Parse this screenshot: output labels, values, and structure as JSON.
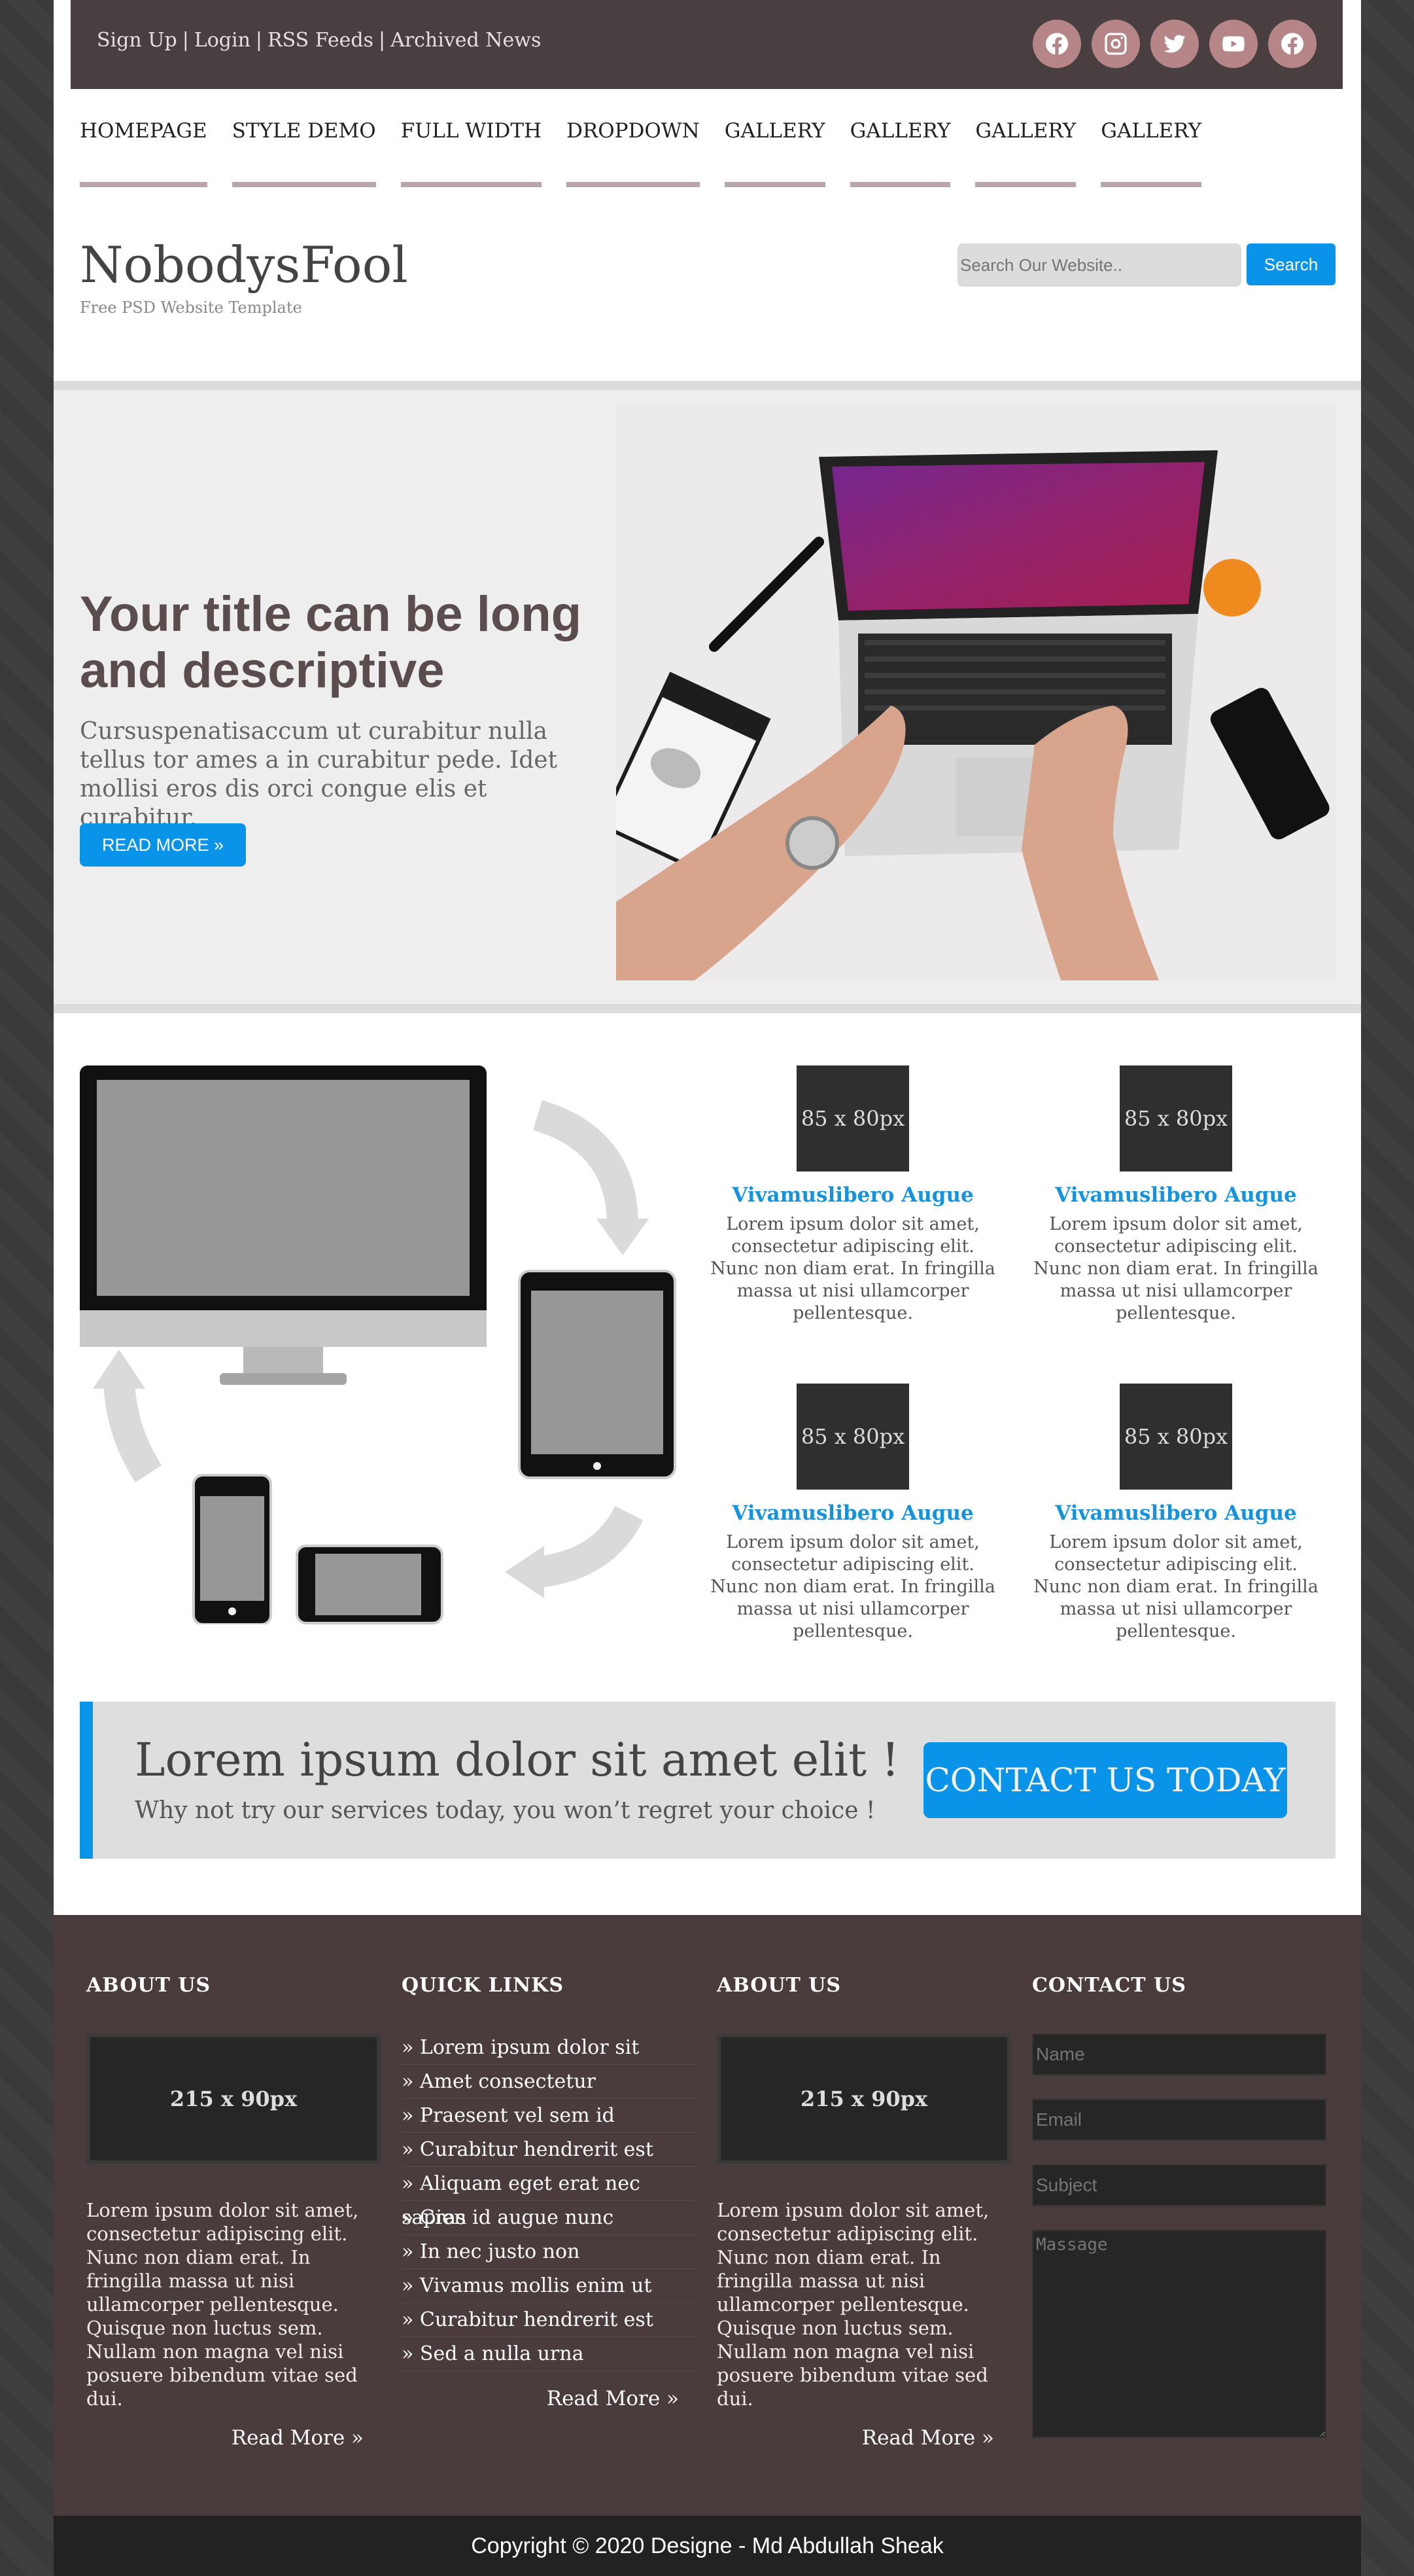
{
  "topbar": {
    "links": [
      "Sign Up",
      "Login",
      "RSS Feeds",
      "Archived News"
    ],
    "social_icons": [
      "facebook-icon",
      "instagram-icon",
      "twitter-icon",
      "youtube-icon",
      "facebook-icon"
    ]
  },
  "nav": {
    "items": [
      "HOMEPAGE",
      "STYLE DEMO",
      "FULL WIDTH",
      "DROPDOWN",
      "GALLERY",
      "GALLERY",
      "GALLERY",
      "GALLERY"
    ]
  },
  "header": {
    "brand": "NobodysFool",
    "tagline": "Free PSD Website Template",
    "search_placeholder": "Search Our Website..",
    "search_button": "Search"
  },
  "hero": {
    "title": "Your title can be long and descriptive",
    "text": "Cursuspenatisaccum ut curabitur nulla tellus tor ames a in curabitur pede. Idet mollisi eros dis orci congue elis et curabitur.",
    "button": "READ MORE »"
  },
  "features": [
    {
      "thumb": "85 x 80px",
      "title": "Vivamuslibero Augue",
      "text": "Lorem ipsum dolor sit amet, consectetur adipiscing elit. Nunc non diam erat. In fringilla massa ut nisi ullamcorper pellentesque."
    },
    {
      "thumb": "85 x 80px",
      "title": "Vivamuslibero Augue",
      "text": "Lorem ipsum dolor sit amet, consectetur adipiscing elit. Nunc non diam erat. In fringilla massa ut nisi ullamcorper pellentesque."
    },
    {
      "thumb": "85 x 80px",
      "title": "Vivamuslibero Augue",
      "text": "Lorem ipsum dolor sit amet, consectetur adipiscing elit. Nunc non diam erat. In fringilla massa ut nisi ullamcorper pellentesque."
    },
    {
      "thumb": "85 x 80px",
      "title": "Vivamuslibero Augue",
      "text": "Lorem ipsum dolor sit amet, consectetur adipiscing elit. Nunc non diam erat. In fringilla massa ut nisi ullamcorper pellentesque."
    }
  ],
  "cta": {
    "heading": "Lorem ipsum dolor sit amet elit !",
    "sub": "Why not try our services today, you won’t regret your choice !",
    "button": "CONTACT US TODAY"
  },
  "footer": {
    "about1": {
      "title": "ABOUT US",
      "placeholder": "215 x 90px",
      "text": "Lorem ipsum dolor sit amet, consectetur adipiscing elit. Nunc non diam erat. In fringilla massa ut nisi ullamcorper pellentesque. Quisque non luctus sem. Nullam non magna vel nisi posuere bibendum vitae sed dui.",
      "read_more": "Read More »"
    },
    "quick_links": {
      "title": "QUICK LINKS",
      "items": [
        "» Lorem ipsum dolor sit",
        "» Amet consectetur",
        "» Praesent vel sem id",
        "» Curabitur hendrerit est",
        "» Aliquam eget erat nec sapien",
        "» Cras id augue nunc",
        "» In nec justo non",
        "» Vivamus mollis enim ut",
        "» Curabitur hendrerit est",
        "» Sed a nulla urna"
      ],
      "read_more": "Read More »"
    },
    "about2": {
      "title": "ABOUT US",
      "placeholder": "215 x 90px",
      "text": "Lorem ipsum dolor sit amet, consectetur adipiscing elit. Nunc non diam erat. In fringilla massa ut nisi ullamcorper pellentesque. Quisque non luctus sem. Nullam non magna vel nisi posuere bibendum vitae sed dui.",
      "read_more": "Read More »"
    },
    "contact": {
      "title": "CONTACT US",
      "name_placeholder": "Name",
      "email_placeholder": "Email",
      "subject_placeholder": "Subject",
      "message_placeholder": "Massage"
    }
  },
  "copyright": "Copyright © 2020 Designe - Md Abdullah Sheak",
  "colors": {
    "accent": "#0994ea",
    "topbar": "#4a3f40",
    "footer": "#4a3c3d",
    "social": "#b58587"
  }
}
